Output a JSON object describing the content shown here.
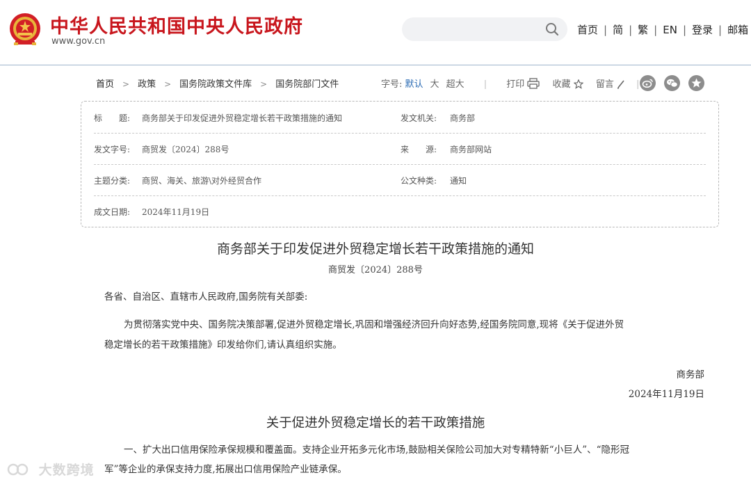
{
  "header": {
    "site_title": "中华人民共和国中央人民政府",
    "site_url": "www.gov.cn",
    "search_placeholder": "",
    "nav": [
      "首页",
      "简",
      "繁",
      "EN",
      "登录",
      "邮箱"
    ]
  },
  "breadcrumb": [
    "首页",
    "政策",
    "国务院政策文件库",
    "国务院部门文件"
  ],
  "toolbar": {
    "font_size_label": "字号:",
    "font_sizes": [
      "默认",
      "大",
      "超大"
    ],
    "active_font_size": "默认",
    "print_label": "打印",
    "favorite_label": "收藏",
    "comment_label": "留言"
  },
  "share_icons": [
    "weibo-icon",
    "wechat-icon",
    "favorite-star-icon"
  ],
  "info": {
    "title_label": "标　　题:",
    "title_value": "商务部关于印发促进外贸稳定增长若干政策措施的通知",
    "issuer_label": "发文机关:",
    "issuer_value": "商务部",
    "doc_no_label": "发文字号:",
    "doc_no_value": "商贸发〔2024〕288号",
    "source_label": "来　　源:",
    "source_value": "商务部网站",
    "topic_label": "主题分类:",
    "topic_value": "商贸、海关、旅游\\对外经贸合作",
    "type_label": "公文种类:",
    "type_value": "通知",
    "date_label": "成文日期:",
    "date_value": "2024年11月19日"
  },
  "article": {
    "title": "商务部关于印发促进外贸稳定增长若干政策措施的通知",
    "doc_no": "商贸发〔2024〕288号",
    "salutation": "各省、自治区、直辖市人民政府,国务院有关部委:",
    "body_line1": "为贯彻落实党中央、国务院决策部署,促进外贸稳定增长,巩固和增强经济回升向好态势,经国务院同意,现将《关于促进外贸",
    "body_line2": "稳定增长的若干政策措施》印发给你们,请认真组织实施。",
    "signature": "商务部",
    "sign_date": "2024年11月19日",
    "section_title": "关于促进外贸稳定增长的若干政策措施",
    "section1_line1": "一、扩大出口信用保险承保规模和覆盖面。支持企业开拓多元化市场,鼓励相关保险公司加大对专精特新“小巨人”、“隐形冠",
    "section1_line2": "军”等企业的承保支持力度,拓展出口信用保险产业链承保。"
  },
  "watermark": "大数跨境"
}
